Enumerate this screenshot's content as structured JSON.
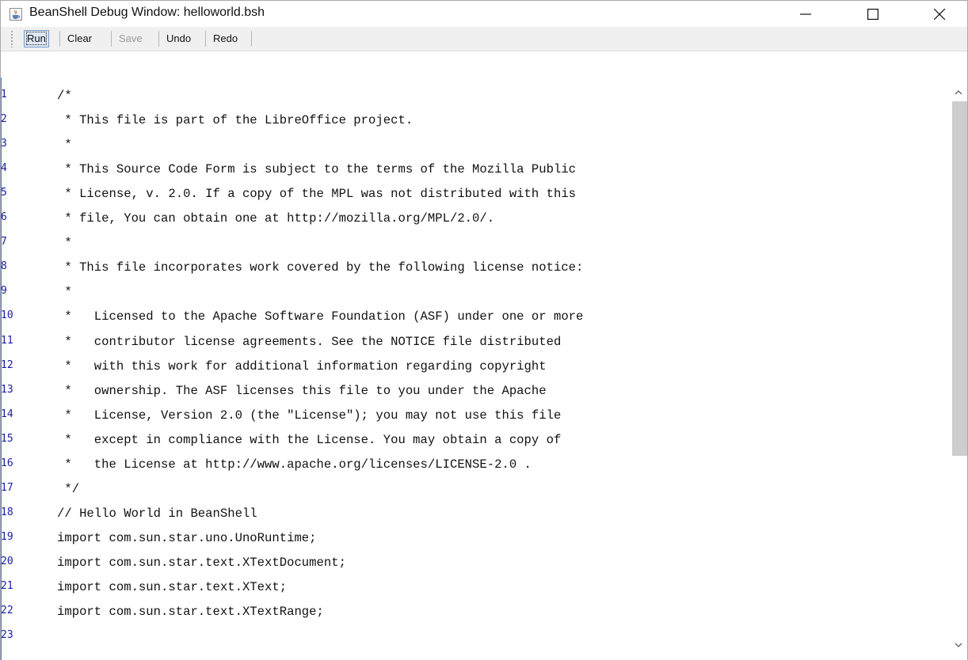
{
  "window": {
    "title": "BeanShell Debug Window: helloworld.bsh",
    "icons": {
      "app": "java-cup-icon",
      "minimize": "minimize-icon",
      "maximize": "maximize-icon",
      "close": "close-icon"
    }
  },
  "toolbar": {
    "run": "Run",
    "clear": "Clear",
    "save": "Save",
    "undo": "Undo",
    "redo": "Redo"
  },
  "editor": {
    "lines": [
      {
        "n": "1",
        "text": "/*"
      },
      {
        "n": "2",
        "text": " * This file is part of the LibreOffice project."
      },
      {
        "n": "3",
        "text": " *"
      },
      {
        "n": "4",
        "text": " * This Source Code Form is subject to the terms of the Mozilla Public"
      },
      {
        "n": "5",
        "text": " * License, v. 2.0. If a copy of the MPL was not distributed with this"
      },
      {
        "n": "6",
        "text": " * file, You can obtain one at http://mozilla.org/MPL/2.0/."
      },
      {
        "n": "7",
        "text": " *"
      },
      {
        "n": "8",
        "text": " * This file incorporates work covered by the following license notice:"
      },
      {
        "n": "9",
        "text": " *"
      },
      {
        "n": "10",
        "text": " *   Licensed to the Apache Software Foundation (ASF) under one or more"
      },
      {
        "n": "11",
        "text": " *   contributor license agreements. See the NOTICE file distributed"
      },
      {
        "n": "12",
        "text": " *   with this work for additional information regarding copyright"
      },
      {
        "n": "13",
        "text": " *   ownership. The ASF licenses this file to you under the Apache"
      },
      {
        "n": "14",
        "text": " *   License, Version 2.0 (the \"License\"); you may not use this file"
      },
      {
        "n": "15",
        "text": " *   except in compliance with the License. You may obtain a copy of"
      },
      {
        "n": "16",
        "text": " *   the License at http://www.apache.org/licenses/LICENSE-2.0 ."
      },
      {
        "n": "17",
        "text": " */"
      },
      {
        "n": "18",
        "text": "// Hello World in BeanShell"
      },
      {
        "n": "19",
        "text": "import com.sun.star.uno.UnoRuntime;"
      },
      {
        "n": "20",
        "text": "import com.sun.star.text.XTextDocument;"
      },
      {
        "n": "21",
        "text": "import com.sun.star.text.XText;"
      },
      {
        "n": "22",
        "text": "import com.sun.star.text.XTextRange;"
      },
      {
        "n": "23",
        "text": ""
      }
    ]
  }
}
